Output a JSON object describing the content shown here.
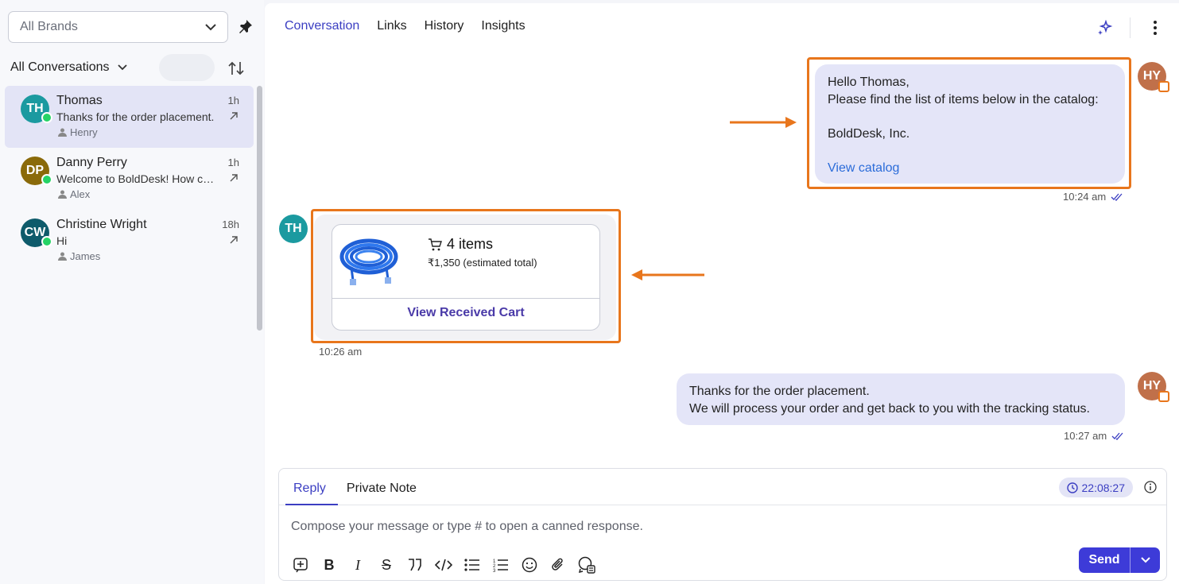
{
  "sidebar": {
    "brand_select": "All Brands",
    "filter": "All Conversations",
    "conversations": [
      {
        "initials": "TH",
        "name": "Thomas",
        "time": "1h",
        "preview": "Thanks for the order placement.",
        "agent": "Henry",
        "color": "#1b9aa0"
      },
      {
        "initials": "DP",
        "name": "Danny Perry",
        "time": "1h",
        "preview": "Welcome to BoldDesk! How can I help you?",
        "agent": "Alex",
        "color": "#8a6a0a"
      },
      {
        "initials": "CW",
        "name": "Christine Wright",
        "time": "18h",
        "preview": "Hi",
        "agent": "James",
        "color": "#0e5b6b"
      }
    ]
  },
  "header": {
    "tabs": [
      "Conversation",
      "Links",
      "History",
      "Insights"
    ]
  },
  "messages": {
    "m1": {
      "avatar": "HY",
      "lines": [
        "Hello Thomas,",
        "Please find the list of items below in the catalog:",
        "",
        "BoldDesk, Inc."
      ],
      "link": "View catalog",
      "time": "10:24 am"
    },
    "m2": {
      "avatar": "TH",
      "items": "4 items",
      "total": "₹1,350 (estimated total)",
      "button": "View Received Cart",
      "time": "10:26 am"
    },
    "m3": {
      "avatar": "HY",
      "lines": [
        "Thanks for the order placement.",
        "We will process your order and get back to you with the tracking status."
      ],
      "time": "10:27 am"
    }
  },
  "composer": {
    "tabs": [
      "Reply",
      "Private Note"
    ],
    "timer": "22:08:27",
    "placeholder": "Compose your message or type # to open a canned response.",
    "send": "Send"
  },
  "colors": {
    "accent": "#3b3ec2",
    "highlight": "#e8761c",
    "bubble": "#e4e5f8",
    "agent_avatar": "#c0704a"
  }
}
